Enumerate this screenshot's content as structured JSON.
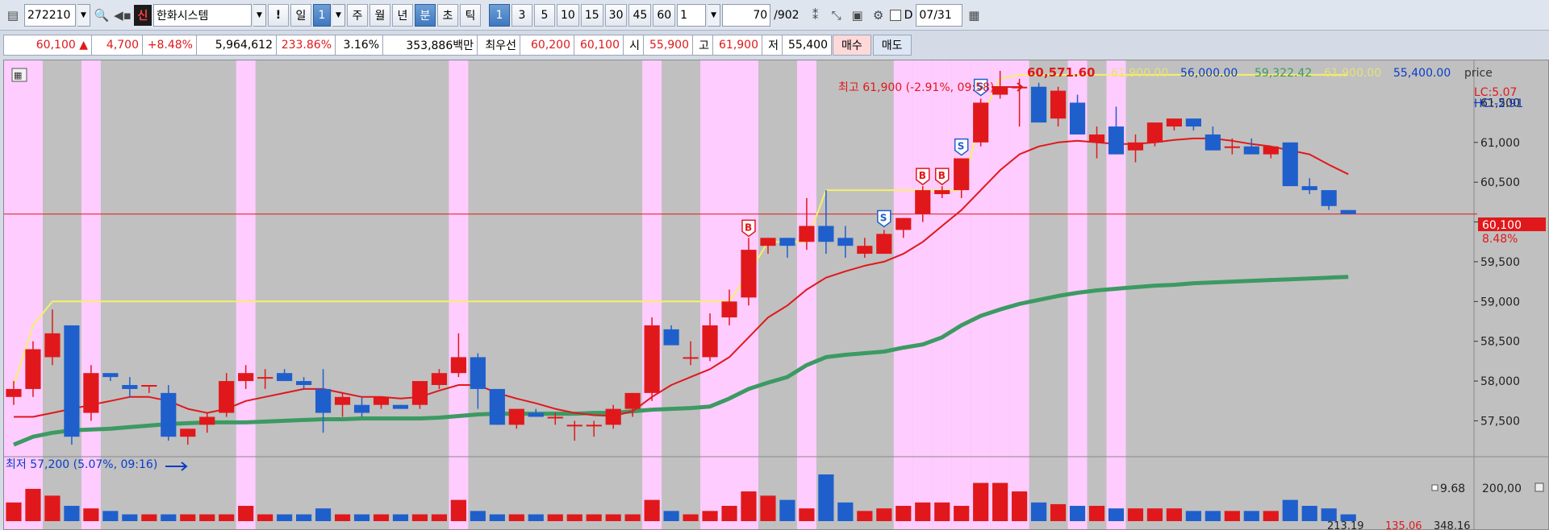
{
  "toolbar": {
    "code": "272210",
    "badge": "신",
    "name": "한화시스템",
    "exclaim": "!",
    "periods": [
      "일",
      "주",
      "월",
      "년",
      "분",
      "초",
      "틱"
    ],
    "day_count": "1",
    "minute_options": [
      "1",
      "3",
      "5",
      "10",
      "15",
      "30",
      "45",
      "60"
    ],
    "active_minute": "1",
    "interval_value": "1",
    "bars_shown": "70",
    "bars_total": "/902",
    "d_label": "D",
    "date": "07/31"
  },
  "info": {
    "price": "60,100",
    "arrow": "▲",
    "change": "4,700",
    "change_pct": "+8.48%",
    "volume": "5,964,612",
    "volume_ratio": "233.86%",
    "turnover": "3.16%",
    "amount": "353,886백만",
    "best_label": "최우선",
    "bid": "60,200",
    "ask": "60,100",
    "open_label": "시",
    "open": "55,900",
    "high_label": "고",
    "high": "61,900",
    "low_label": "저",
    "low": "55,400",
    "buy_label": "매수",
    "sell_label": "매도"
  },
  "legend": {
    "current": "60,571.60",
    "v2": "61,900.00",
    "v3": "56,000.00",
    "v4": "59,322.42",
    "v5": "61,900.00",
    "v6": "55,400.00",
    "v7": "price",
    "lc": "LC:5.07",
    "hc": "HC:-2.91"
  },
  "annotations": {
    "high_note": "최고 61,900 (-2.91%, 09:58)",
    "low_note": "최저 57,200 (5.07%, 09:16)",
    "price_tag": "60,100",
    "price_pct": "8.48%"
  },
  "volume_panel": {
    "top_label": "9.68",
    "scale_label": "200,00",
    "bottom_label": "213,19",
    "bottom_red": "135,06",
    "bottom_right": "348,16"
  },
  "colors": {
    "up": "#e0181b",
    "down": "#1f5fcc",
    "ma_short": "#e0181b",
    "ma_long": "#3c9a62",
    "envelope": "#f7ef6a",
    "highlight": "#ffccff"
  },
  "chart_data": {
    "type": "candlestick",
    "y_ticks": [
      "57,500",
      "58,000",
      "58,500",
      "59,000",
      "59,500",
      "60,000",
      "60,500",
      "61,000",
      "61,500"
    ],
    "ylim": [
      57150,
      61950
    ],
    "candles": [
      {
        "o": 57800,
        "h": 58000,
        "l": 57700,
        "c": 57900
      },
      {
        "o": 57900,
        "h": 58500,
        "l": 57800,
        "c": 58400
      },
      {
        "o": 58300,
        "h": 58900,
        "l": 58200,
        "c": 58600
      },
      {
        "o": 58700,
        "h": 58700,
        "l": 57200,
        "c": 57300
      },
      {
        "o": 57600,
        "h": 58200,
        "l": 57500,
        "c": 58100
      },
      {
        "o": 58100,
        "h": 58100,
        "l": 58000,
        "c": 58050
      },
      {
        "o": 57950,
        "h": 58050,
        "l": 57800,
        "c": 57900
      },
      {
        "o": 57950,
        "h": 57950,
        "l": 57850,
        "c": 57950
      },
      {
        "o": 57850,
        "h": 57950,
        "l": 57250,
        "c": 57300
      },
      {
        "o": 57300,
        "h": 57400,
        "l": 57200,
        "c": 57400
      },
      {
        "o": 57450,
        "h": 57600,
        "l": 57350,
        "c": 57550
      },
      {
        "o": 57600,
        "h": 58100,
        "l": 57550,
        "c": 58000
      },
      {
        "o": 58000,
        "h": 58200,
        "l": 57900,
        "c": 58100
      },
      {
        "o": 58050,
        "h": 58150,
        "l": 57900,
        "c": 58050
      },
      {
        "o": 58100,
        "h": 58150,
        "l": 58000,
        "c": 58000
      },
      {
        "o": 58000,
        "h": 58050,
        "l": 57900,
        "c": 57950
      },
      {
        "o": 57900,
        "h": 58150,
        "l": 57350,
        "c": 57600
      },
      {
        "o": 57700,
        "h": 57850,
        "l": 57550,
        "c": 57800
      },
      {
        "o": 57700,
        "h": 57800,
        "l": 57550,
        "c": 57600
      },
      {
        "o": 57700,
        "h": 57800,
        "l": 57650,
        "c": 57800
      },
      {
        "o": 57700,
        "h": 57700,
        "l": 57650,
        "c": 57650
      },
      {
        "o": 57700,
        "h": 58000,
        "l": 57650,
        "c": 58000
      },
      {
        "o": 57950,
        "h": 58150,
        "l": 57900,
        "c": 58100
      },
      {
        "o": 58100,
        "h": 58600,
        "l": 58050,
        "c": 58300
      },
      {
        "o": 58300,
        "h": 58350,
        "l": 57650,
        "c": 57900
      },
      {
        "o": 57900,
        "h": 57900,
        "l": 57450,
        "c": 57450
      },
      {
        "o": 57450,
        "h": 57650,
        "l": 57400,
        "c": 57650
      },
      {
        "o": 57600,
        "h": 57650,
        "l": 57550,
        "c": 57550
      },
      {
        "o": 57550,
        "h": 57600,
        "l": 57450,
        "c": 57550
      },
      {
        "o": 57450,
        "h": 57500,
        "l": 57250,
        "c": 57450
      },
      {
        "o": 57450,
        "h": 57500,
        "l": 57300,
        "c": 57450
      },
      {
        "o": 57450,
        "h": 57700,
        "l": 57400,
        "c": 57650
      },
      {
        "o": 57650,
        "h": 57850,
        "l": 57550,
        "c": 57850
      },
      {
        "o": 57850,
        "h": 58800,
        "l": 57750,
        "c": 58700
      },
      {
        "o": 58650,
        "h": 58700,
        "l": 58450,
        "c": 58450
      },
      {
        "o": 58300,
        "h": 58500,
        "l": 58200,
        "c": 58300
      },
      {
        "o": 58300,
        "h": 58850,
        "l": 58250,
        "c": 58700
      },
      {
        "o": 58800,
        "h": 59150,
        "l": 58700,
        "c": 59000
      },
      {
        "o": 59050,
        "h": 59800,
        "l": 58950,
        "c": 59650
      },
      {
        "o": 59700,
        "h": 59800,
        "l": 59600,
        "c": 59800
      },
      {
        "o": 59800,
        "h": 59800,
        "l": 59550,
        "c": 59700
      },
      {
        "o": 59750,
        "h": 60300,
        "l": 59650,
        "c": 59950
      },
      {
        "o": 59950,
        "h": 60400,
        "l": 59600,
        "c": 59750
      },
      {
        "o": 59800,
        "h": 59950,
        "l": 59550,
        "c": 59700
      },
      {
        "o": 59600,
        "h": 59800,
        "l": 59550,
        "c": 59700
      },
      {
        "o": 59600,
        "h": 59900,
        "l": 59600,
        "c": 59850
      },
      {
        "o": 59900,
        "h": 60050,
        "l": 59800,
        "c": 60050
      },
      {
        "o": 60100,
        "h": 60450,
        "l": 60000,
        "c": 60400
      },
      {
        "o": 60350,
        "h": 60450,
        "l": 60300,
        "c": 60400
      },
      {
        "o": 60400,
        "h": 60800,
        "l": 60300,
        "c": 60800
      },
      {
        "o": 61000,
        "h": 61550,
        "l": 60950,
        "c": 61500
      },
      {
        "o": 61600,
        "h": 61900,
        "l": 61550,
        "c": 61700
      },
      {
        "o": 61700,
        "h": 61800,
        "l": 61200,
        "c": 61700
      },
      {
        "o": 61700,
        "h": 61750,
        "l": 61300,
        "c": 61250
      },
      {
        "o": 61300,
        "h": 61700,
        "l": 61200,
        "c": 61650
      },
      {
        "o": 61500,
        "h": 61600,
        "l": 61100,
        "c": 61100
      },
      {
        "o": 61000,
        "h": 61200,
        "l": 60800,
        "c": 61100
      },
      {
        "o": 61200,
        "h": 61450,
        "l": 60850,
        "c": 60850
      },
      {
        "o": 60900,
        "h": 61100,
        "l": 60750,
        "c": 61000
      },
      {
        "o": 61000,
        "h": 61250,
        "l": 60950,
        "c": 61250
      },
      {
        "o": 61200,
        "h": 61300,
        "l": 61150,
        "c": 61300
      },
      {
        "o": 61300,
        "h": 61300,
        "l": 61150,
        "c": 61200
      },
      {
        "o": 61100,
        "h": 61200,
        "l": 60900,
        "c": 60900
      },
      {
        "o": 60950,
        "h": 61050,
        "l": 60850,
        "c": 60950
      },
      {
        "o": 60950,
        "h": 61050,
        "l": 60850,
        "c": 60850
      },
      {
        "o": 60850,
        "h": 60950,
        "l": 60800,
        "c": 60950
      },
      {
        "o": 61000,
        "h": 61000,
        "l": 60450,
        "c": 60450
      },
      {
        "o": 60450,
        "h": 60550,
        "l": 60350,
        "c": 60400
      },
      {
        "o": 60400,
        "h": 60400,
        "l": 60150,
        "c": 60200
      },
      {
        "o": 60150,
        "h": 60150,
        "l": 60100,
        "c": 60100
      }
    ],
    "volumes": [
      22,
      38,
      30,
      18,
      15,
      12,
      8,
      8,
      8,
      8,
      8,
      8,
      18,
      8,
      8,
      8,
      15,
      8,
      8,
      8,
      8,
      8,
      8,
      25,
      12,
      8,
      8,
      8,
      8,
      8,
      8,
      8,
      8,
      25,
      12,
      8,
      12,
      18,
      35,
      30,
      25,
      15,
      55,
      22,
      12,
      15,
      18,
      22,
      22,
      18,
      45,
      45,
      35,
      22,
      20,
      18,
      18,
      15,
      15,
      15,
      15,
      12,
      12,
      12,
      12,
      12,
      25,
      18,
      15,
      8
    ],
    "ma_short": [
      57550,
      57550,
      57600,
      57650,
      57700,
      57750,
      57800,
      57800,
      57750,
      57650,
      57600,
      57650,
      57750,
      57800,
      57850,
      57900,
      57900,
      57850,
      57800,
      57800,
      57780,
      57800,
      57880,
      57950,
      57950,
      57850,
      57780,
      57720,
      57650,
      57600,
      57570,
      57560,
      57620,
      57800,
      57950,
      58050,
      58150,
      58300,
      58550,
      58800,
      58950,
      59150,
      59300,
      59380,
      59450,
      59500,
      59600,
      59750,
      59950,
      60150,
      60400,
      60650,
      60850,
      60950,
      61000,
      61020,
      61000,
      60980,
      60980,
      61000,
      61030,
      61050,
      61050,
      61020,
      60980,
      60950,
      60900,
      60850,
      60720,
      60600
    ],
    "ma_long": [
      57200,
      57300,
      57350,
      57380,
      57390,
      57400,
      57420,
      57440,
      57460,
      57470,
      57480,
      57480,
      57480,
      57490,
      57500,
      57510,
      57520,
      57520,
      57530,
      57530,
      57530,
      57530,
      57540,
      57560,
      57580,
      57590,
      57590,
      57590,
      57590,
      57590,
      57600,
      57600,
      57620,
      57640,
      57650,
      57660,
      57680,
      57780,
      57900,
      57980,
      58050,
      58200,
      58300,
      58330,
      58350,
      58370,
      58420,
      58460,
      58550,
      58700,
      58820,
      58900,
      58970,
      59020,
      59070,
      59110,
      59140,
      59160,
      59180,
      59200,
      59210,
      59230,
      59240,
      59250,
      59260,
      59270,
      59280,
      59290,
      59300,
      59310
    ],
    "envelope": [
      57950,
      58700,
      59000,
      59000,
      59000,
      59000,
      59000,
      59000,
      59000,
      59000,
      59000,
      59000,
      59000,
      59000,
      59000,
      59000,
      59000,
      59000,
      59000,
      59000,
      59000,
      59000,
      59000,
      59000,
      59000,
      59000,
      59000,
      59000,
      59000,
      59000,
      59000,
      59000,
      59000,
      59000,
      59000,
      59000,
      59000,
      59000,
      59350,
      59750,
      59750,
      59750,
      60400,
      60400,
      60400,
      60400,
      60400,
      60400,
      60400,
      60400,
      61300,
      61800,
      61850,
      61850,
      61850,
      61850,
      61850,
      61850,
      61850,
      61850,
      61850,
      61850,
      61850,
      61850,
      61850,
      61850,
      61850,
      61850,
      61850,
      61850
    ],
    "highlight_bars": [
      0,
      1,
      4,
      12,
      23,
      33,
      36,
      37,
      38,
      41,
      46,
      47,
      48,
      49,
      50,
      51,
      52,
      55,
      57
    ],
    "signals": [
      {
        "bar": 38,
        "type": "B"
      },
      {
        "bar": 45,
        "type": "S"
      },
      {
        "bar": 47,
        "type": "B"
      },
      {
        "bar": 48,
        "type": "B"
      },
      {
        "bar": 49,
        "type": "S"
      },
      {
        "bar": 50,
        "type": "S"
      }
    ],
    "reference_price": 60100
  }
}
